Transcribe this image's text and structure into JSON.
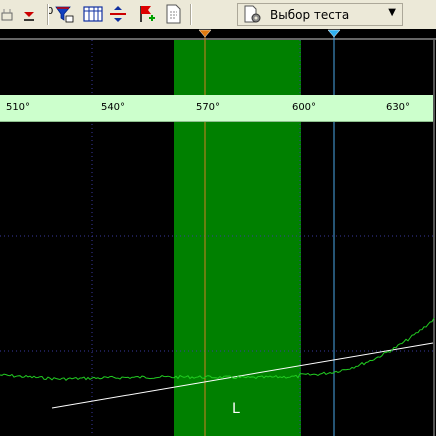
{
  "toolbar": {
    "counter_value": "0",
    "test_select": {
      "label": "Выбор теста"
    },
    "icons": [
      "scale-icon",
      "marker-zero-icon",
      "filter-icon",
      "table-icon",
      "split-icon",
      "flag-add-icon",
      "document-icon",
      "gear-icon",
      "dropdown-arrow-icon"
    ]
  },
  "scale": {
    "ticks": [
      "510°",
      "540°",
      "570°",
      "600°",
      "630°"
    ]
  },
  "plot": {
    "zone_label": "L",
    "colors": {
      "background": "#000000",
      "zone": "#008000",
      "curve": "#22cc22",
      "fit_line": "#ffffff",
      "marker_1": "#d08020",
      "marker_2": "#4aa8e8",
      "scale_bar": "#ccffcc"
    }
  }
}
